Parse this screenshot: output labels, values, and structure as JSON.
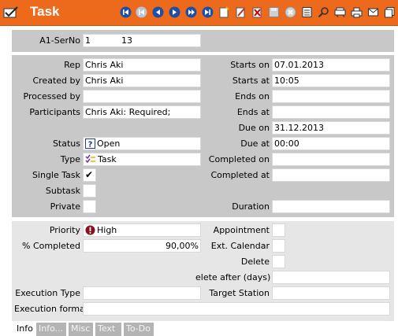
{
  "window": {
    "title": "Task"
  },
  "toolbar": {
    "icons": [
      "first-icon",
      "prev-page-icon",
      "prev-icon",
      "next-icon",
      "next-page-icon",
      "last-icon",
      "new-doc-icon",
      "edit-icon",
      "delete-icon",
      "save-icon",
      "cancel-icon",
      "list-icon",
      "search-icon",
      "tools-icon",
      "print-icon",
      "mail-icon",
      "copy-icon"
    ]
  },
  "header": {
    "serno_label": "A1-SerNo",
    "serno_prefix": "1",
    "serno_number": "13"
  },
  "details": {
    "rep_label": "Rep",
    "rep_value": "Chris Aki",
    "created_by_label": "Created by",
    "created_by_value": "Chris Aki",
    "processed_by_label": "Processed by",
    "processed_by_value": "",
    "participants_label": "Participants",
    "participants_value": "Chris Aki: Required;",
    "status_label": "Status",
    "status_value": "Open",
    "type_label": "Type",
    "type_value": "Task",
    "single_task_label": "Single Task",
    "single_task_check": "✔",
    "subtask_label": "Subtask",
    "private_label": "Private",
    "starts_on_label": "Starts on",
    "starts_on_value": "07.01.2013",
    "starts_at_label": "Starts at",
    "starts_at_value": "10:05",
    "ends_on_label": "Ends on",
    "ends_on_value": "",
    "ends_at_label": "Ends at",
    "ends_at_value": "",
    "due_on_label": "Due on",
    "due_on_value": "31.12.2013",
    "due_at_label": "Due at",
    "due_at_value": "00:00",
    "completed_on_label": "Completed on",
    "completed_on_value": "",
    "completed_at_label": "Completed at",
    "completed_at_value": "",
    "duration_label": "Duration",
    "duration_value": ""
  },
  "extra": {
    "priority_label": "Priority",
    "priority_value": "High",
    "pct_completed_label": "% Completed",
    "pct_completed_value": "90,00%",
    "appointment_label": "Appointment",
    "ext_calendar_label": "Ext. Calendar",
    "delete_label": "Delete",
    "delete_after_label": "elete after (days)",
    "delete_after_value": "",
    "execution_type_label": "Execution Type",
    "execution_type_value": "",
    "target_station_label": "Target Station",
    "target_station_value": "",
    "execution_format_label": "Execution format",
    "execution_format_value": ""
  },
  "tabs": [
    {
      "label": "Info",
      "active": true
    },
    {
      "label": "Info...",
      "active": false
    },
    {
      "label": "Misc",
      "active": false
    },
    {
      "label": "Text",
      "active": false
    },
    {
      "label": "To-Do",
      "active": false
    }
  ],
  "colors": {
    "titlebar": "#ed6a1c",
    "panel": "#c8c8c8",
    "panel_light": "#e6e6e6"
  }
}
